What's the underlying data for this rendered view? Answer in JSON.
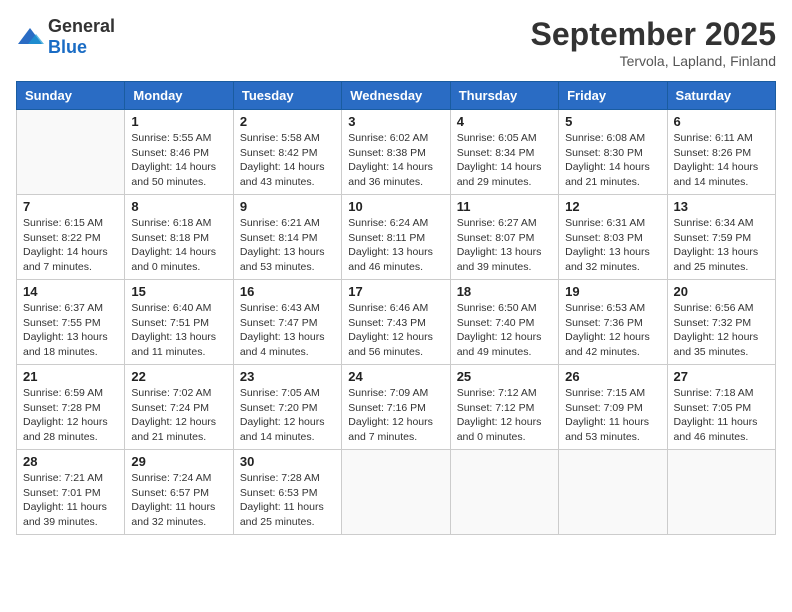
{
  "logo": {
    "general": "General",
    "blue": "Blue"
  },
  "header": {
    "month": "September 2025",
    "location": "Tervola, Lapland, Finland"
  },
  "weekdays": [
    "Sunday",
    "Monday",
    "Tuesday",
    "Wednesday",
    "Thursday",
    "Friday",
    "Saturday"
  ],
  "weeks": [
    [
      {
        "day": "",
        "info": ""
      },
      {
        "day": "1",
        "info": "Sunrise: 5:55 AM\nSunset: 8:46 PM\nDaylight: 14 hours\nand 50 minutes."
      },
      {
        "day": "2",
        "info": "Sunrise: 5:58 AM\nSunset: 8:42 PM\nDaylight: 14 hours\nand 43 minutes."
      },
      {
        "day": "3",
        "info": "Sunrise: 6:02 AM\nSunset: 8:38 PM\nDaylight: 14 hours\nand 36 minutes."
      },
      {
        "day": "4",
        "info": "Sunrise: 6:05 AM\nSunset: 8:34 PM\nDaylight: 14 hours\nand 29 minutes."
      },
      {
        "day": "5",
        "info": "Sunrise: 6:08 AM\nSunset: 8:30 PM\nDaylight: 14 hours\nand 21 minutes."
      },
      {
        "day": "6",
        "info": "Sunrise: 6:11 AM\nSunset: 8:26 PM\nDaylight: 14 hours\nand 14 minutes."
      }
    ],
    [
      {
        "day": "7",
        "info": "Sunrise: 6:15 AM\nSunset: 8:22 PM\nDaylight: 14 hours\nand 7 minutes."
      },
      {
        "day": "8",
        "info": "Sunrise: 6:18 AM\nSunset: 8:18 PM\nDaylight: 14 hours\nand 0 minutes."
      },
      {
        "day": "9",
        "info": "Sunrise: 6:21 AM\nSunset: 8:14 PM\nDaylight: 13 hours\nand 53 minutes."
      },
      {
        "day": "10",
        "info": "Sunrise: 6:24 AM\nSunset: 8:11 PM\nDaylight: 13 hours\nand 46 minutes."
      },
      {
        "day": "11",
        "info": "Sunrise: 6:27 AM\nSunset: 8:07 PM\nDaylight: 13 hours\nand 39 minutes."
      },
      {
        "day": "12",
        "info": "Sunrise: 6:31 AM\nSunset: 8:03 PM\nDaylight: 13 hours\nand 32 minutes."
      },
      {
        "day": "13",
        "info": "Sunrise: 6:34 AM\nSunset: 7:59 PM\nDaylight: 13 hours\nand 25 minutes."
      }
    ],
    [
      {
        "day": "14",
        "info": "Sunrise: 6:37 AM\nSunset: 7:55 PM\nDaylight: 13 hours\nand 18 minutes."
      },
      {
        "day": "15",
        "info": "Sunrise: 6:40 AM\nSunset: 7:51 PM\nDaylight: 13 hours\nand 11 minutes."
      },
      {
        "day": "16",
        "info": "Sunrise: 6:43 AM\nSunset: 7:47 PM\nDaylight: 13 hours\nand 4 minutes."
      },
      {
        "day": "17",
        "info": "Sunrise: 6:46 AM\nSunset: 7:43 PM\nDaylight: 12 hours\nand 56 minutes."
      },
      {
        "day": "18",
        "info": "Sunrise: 6:50 AM\nSunset: 7:40 PM\nDaylight: 12 hours\nand 49 minutes."
      },
      {
        "day": "19",
        "info": "Sunrise: 6:53 AM\nSunset: 7:36 PM\nDaylight: 12 hours\nand 42 minutes."
      },
      {
        "day": "20",
        "info": "Sunrise: 6:56 AM\nSunset: 7:32 PM\nDaylight: 12 hours\nand 35 minutes."
      }
    ],
    [
      {
        "day": "21",
        "info": "Sunrise: 6:59 AM\nSunset: 7:28 PM\nDaylight: 12 hours\nand 28 minutes."
      },
      {
        "day": "22",
        "info": "Sunrise: 7:02 AM\nSunset: 7:24 PM\nDaylight: 12 hours\nand 21 minutes."
      },
      {
        "day": "23",
        "info": "Sunrise: 7:05 AM\nSunset: 7:20 PM\nDaylight: 12 hours\nand 14 minutes."
      },
      {
        "day": "24",
        "info": "Sunrise: 7:09 AM\nSunset: 7:16 PM\nDaylight: 12 hours\nand 7 minutes."
      },
      {
        "day": "25",
        "info": "Sunrise: 7:12 AM\nSunset: 7:12 PM\nDaylight: 12 hours\nand 0 minutes."
      },
      {
        "day": "26",
        "info": "Sunrise: 7:15 AM\nSunset: 7:09 PM\nDaylight: 11 hours\nand 53 minutes."
      },
      {
        "day": "27",
        "info": "Sunrise: 7:18 AM\nSunset: 7:05 PM\nDaylight: 11 hours\nand 46 minutes."
      }
    ],
    [
      {
        "day": "28",
        "info": "Sunrise: 7:21 AM\nSunset: 7:01 PM\nDaylight: 11 hours\nand 39 minutes."
      },
      {
        "day": "29",
        "info": "Sunrise: 7:24 AM\nSunset: 6:57 PM\nDaylight: 11 hours\nand 32 minutes."
      },
      {
        "day": "30",
        "info": "Sunrise: 7:28 AM\nSunset: 6:53 PM\nDaylight: 11 hours\nand 25 minutes."
      },
      {
        "day": "",
        "info": ""
      },
      {
        "day": "",
        "info": ""
      },
      {
        "day": "",
        "info": ""
      },
      {
        "day": "",
        "info": ""
      }
    ]
  ]
}
